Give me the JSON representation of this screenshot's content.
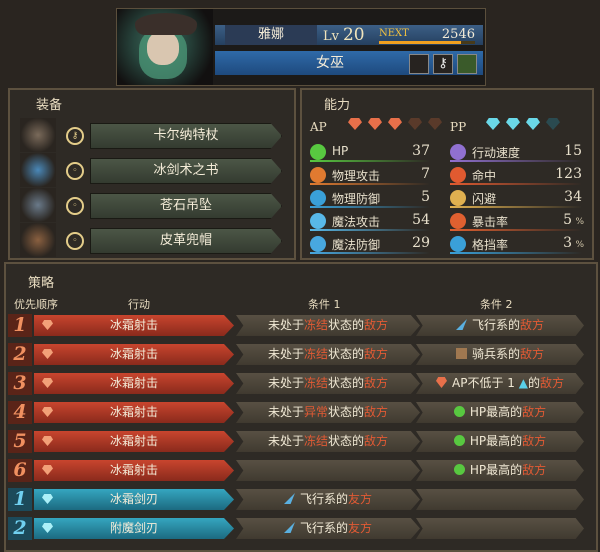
{
  "character": {
    "name": "雅娜",
    "level_label": "Lv",
    "level": "20",
    "next_label": "NEXT",
    "next_value": "2546",
    "next_progress": 0.85,
    "class": "女巫"
  },
  "equipment": {
    "title": "装备",
    "items": [
      {
        "name": "卡尔纳特杖",
        "icon": "staff-icon",
        "type_icon": "key-icon"
      },
      {
        "name": "冰剑术之书",
        "icon": "spellbook-icon",
        "type_icon": "ring-icon"
      },
      {
        "name": "苍石吊坠",
        "icon": "pendant-icon",
        "type_icon": "ring-icon"
      },
      {
        "name": "皮革兜帽",
        "icon": "hood-icon",
        "type_icon": "ring-icon"
      }
    ]
  },
  "ability": {
    "title": "能力",
    "ap_label": "AP",
    "pp_label": "PP",
    "ap_gems": 3,
    "ap_gems_max": 5,
    "pp_gems": 3,
    "pp_gems_max": 4,
    "stats_left": [
      {
        "label": "HP",
        "value": "37",
        "icon": "heart-icon",
        "color": "#58c840"
      },
      {
        "label": "物理攻击",
        "value": "7",
        "icon": "sword-icon",
        "color": "#e07a30"
      },
      {
        "label": "物理防御",
        "value": "5",
        "icon": "shield-icon",
        "color": "#3aa0d8"
      },
      {
        "label": "魔法攻击",
        "value": "54",
        "icon": "wand-icon",
        "color": "#58b8e8"
      },
      {
        "label": "魔法防御",
        "value": "29",
        "icon": "magic-shield-icon",
        "color": "#48a8e0"
      }
    ],
    "stats_right": [
      {
        "label": "行动速度",
        "value": "15",
        "icon": "boot-icon",
        "color": "#9070d0"
      },
      {
        "label": "命中",
        "value": "123",
        "icon": "target-icon",
        "color": "#e05a30"
      },
      {
        "label": "闪避",
        "value": "34",
        "icon": "wing-icon",
        "color": "#e0b050"
      },
      {
        "label": "暴击率",
        "value": "5",
        "unit": "%",
        "icon": "burst-icon",
        "color": "#e06030"
      },
      {
        "label": "格挡率",
        "value": "3",
        "unit": "%",
        "icon": "block-icon",
        "color": "#3aa0d8"
      }
    ]
  },
  "strategy": {
    "title": "策略",
    "headers": {
      "priority": "优先顺序",
      "action": "行动",
      "cond1": "条件 1",
      "cond2": "条件 2"
    },
    "rows": [
      {
        "num": "1",
        "kind": "ap",
        "action": "冰霜射击",
        "c1_pre": "未处于",
        "c1_hl": "冻结",
        "c1_mid": "状态的",
        "c1_hl2": "敌方",
        "c2_icon": "wing-icon",
        "c2_pre": "飞行系的",
        "c2_hl": "敌方"
      },
      {
        "num": "2",
        "kind": "ap",
        "action": "冰霜射击",
        "c1_pre": "未处于",
        "c1_hl": "冻结",
        "c1_mid": "状态的",
        "c1_hl2": "敌方",
        "c2_icon": "horse-icon",
        "c2_pre": "骑兵系的",
        "c2_hl": "敌方"
      },
      {
        "num": "3",
        "kind": "ap",
        "action": "冰霜射击",
        "c1_pre": "未处于",
        "c1_hl": "冻结",
        "c1_mid": "状态的",
        "c1_hl2": "敌方",
        "c2_icon": "ap-gem-icon",
        "c2_pre": "AP不低于 1 ",
        "c2_mid_icon": "triangle-up-icon",
        "c2_post": "的",
        "c2_hl": "敌方"
      },
      {
        "num": "4",
        "kind": "ap",
        "action": "冰霜射击",
        "c1_pre": "未处于",
        "c1_hl": "异常",
        "c1_mid": "状态的",
        "c1_hl2": "敌方",
        "c2_icon": "heart-icon",
        "c2_pre": "HP最高的",
        "c2_hl": "敌方"
      },
      {
        "num": "5",
        "kind": "ap",
        "action": "冰霜射击",
        "c1_pre": "未处于",
        "c1_hl": "冻结",
        "c1_mid": "状态的",
        "c1_hl2": "敌方",
        "c2_icon": "heart-icon",
        "c2_pre": "HP最高的",
        "c2_hl": "敌方"
      },
      {
        "num": "6",
        "kind": "ap",
        "action": "冰霜射击",
        "c1_pre": "",
        "c1_hl": "",
        "c1_mid": "",
        "c1_hl2": "",
        "c2_icon": "heart-icon",
        "c2_pre": "HP最高的",
        "c2_hl": "敌方"
      },
      {
        "num": "1",
        "kind": "pp",
        "action": "冰霜剑刃",
        "c1_icon": "wing-icon",
        "c1_pre": "飞行系的",
        "c1_hl": "友方",
        "c1_mid": "",
        "c1_hl2": "",
        "c2_pre": "",
        "c2_hl": ""
      },
      {
        "num": "2",
        "kind": "pp",
        "action": "附魔剑刃",
        "c1_icon": "wing-icon",
        "c1_pre": "飞行系的",
        "c1_hl": "友方",
        "c1_mid": "",
        "c1_hl2": "",
        "c2_pre": "",
        "c2_hl": ""
      }
    ]
  },
  "colors": {
    "ap_row": "#b83a2a",
    "pp_row": "#2a8aa0",
    "highlight": "#e25a34",
    "panel_border": "#5d513f"
  }
}
